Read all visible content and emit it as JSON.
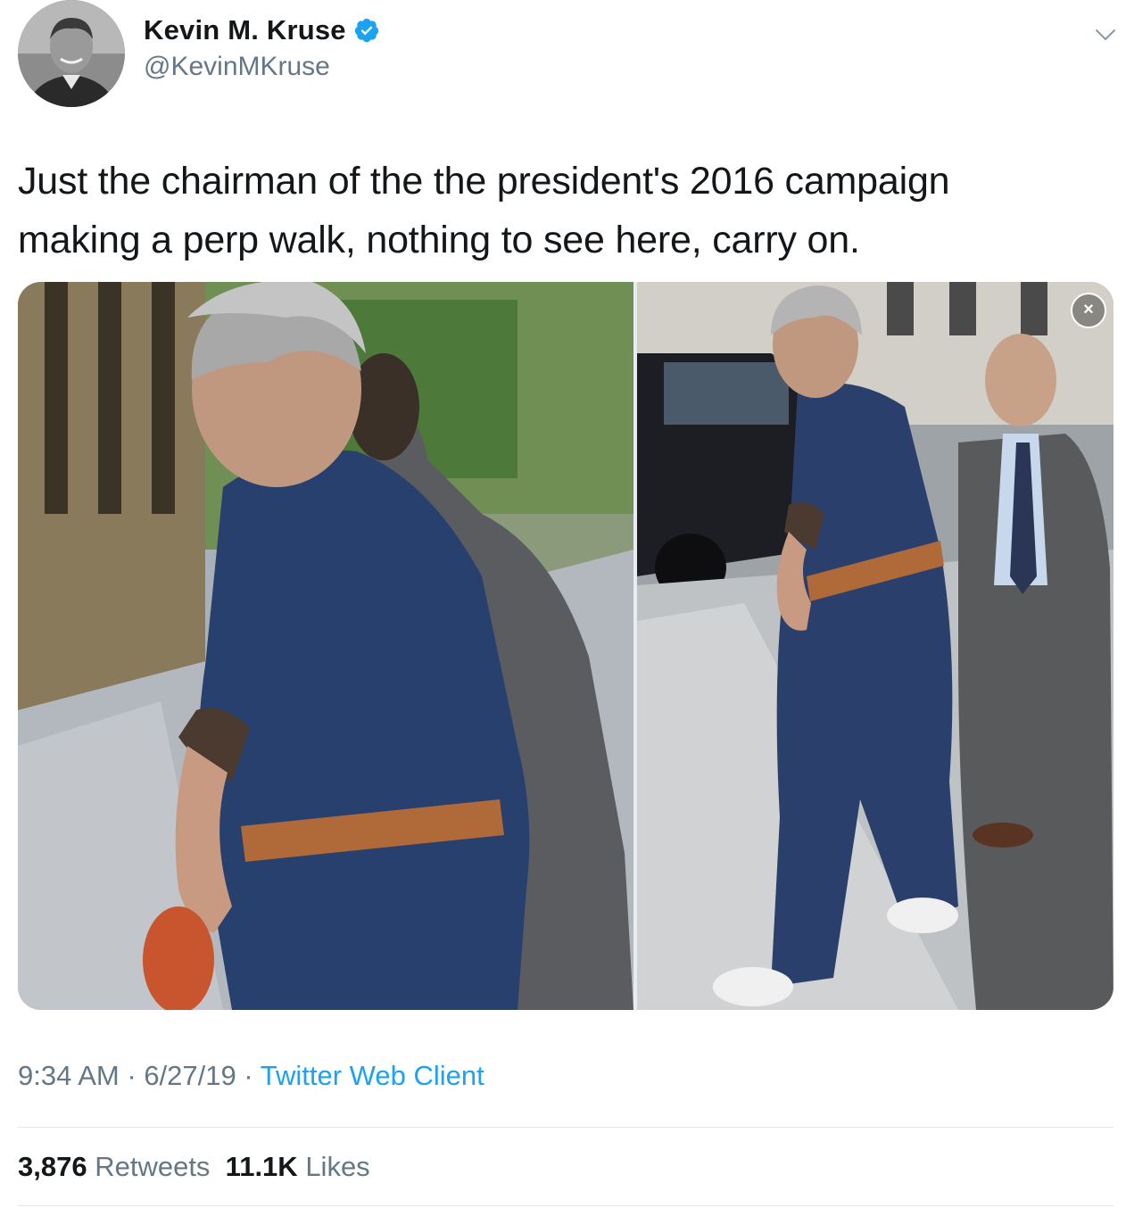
{
  "author": {
    "display_name": "Kevin M. Kruse",
    "handle": "@KevinMKruse",
    "verified": true,
    "avatar_icon": "profile-photo"
  },
  "tweet": {
    "text_line1": "Just the chairman of the the president's 2016 campaign",
    "text_line2": "making a perp walk, nothing to see here, carry on.",
    "media": {
      "photo_count": 2,
      "close_icon": "close-icon"
    }
  },
  "meta": {
    "time": "9:34 AM",
    "sep1": " · ",
    "date": "6/27/19",
    "sep2": " · ",
    "client": "Twitter Web Client"
  },
  "stats": {
    "retweets_count": "3,876",
    "retweets_label": "Retweets",
    "likes_count": "11.1K",
    "likes_label": "Likes"
  },
  "colors": {
    "text_primary": "#14171a",
    "text_secondary": "#657786",
    "link": "#1da1f2",
    "divider": "#e1e8ed"
  }
}
